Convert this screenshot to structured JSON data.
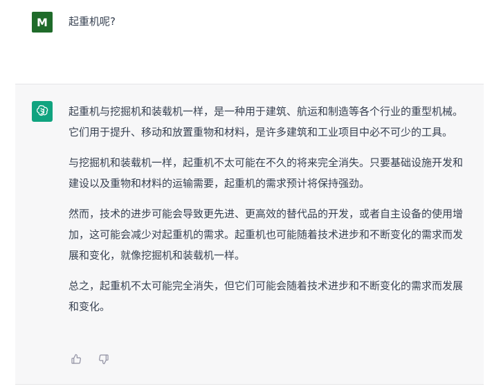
{
  "user": {
    "avatar_letter": "M",
    "message": "起重机呢?"
  },
  "assistant": {
    "paragraphs": [
      "起重机与挖掘机和装载机一样，是一种用于建筑、航运和制造等各个行业的重型机械。它们用于提升、移动和放置重物和材料，是许多建筑和工业项目中必不可少的工具。",
      "与挖掘机和装载机一样，起重机不太可能在不久的将来完全消失。只要基础设施开发和建设以及重物和材料的运输需要，起重机的需求预计将保持强劲。",
      "然而，技术的进步可能会导致更先进、更高效的替代品的开发，或者自主设备的使用增加，这可能会减少对起重机的需求。起重机也可能随着技术进步和不断变化的需求而发展和变化，就像挖掘机和装载机一样。",
      "总之，起重机不太可能完全消失，但它们可能会随着技术进步和不断变化的需求而发展和变化。"
    ]
  },
  "icons": {
    "assistant_logo": "openai-logo-icon",
    "thumbs_up": "thumbs-up-icon",
    "thumbs_down": "thumbs-down-icon"
  },
  "colors": {
    "user_avatar_bg": "#1f6b2a",
    "assistant_avatar_bg": "#10a37f",
    "assistant_row_bg": "#f7f7f8",
    "text": "#374151"
  }
}
